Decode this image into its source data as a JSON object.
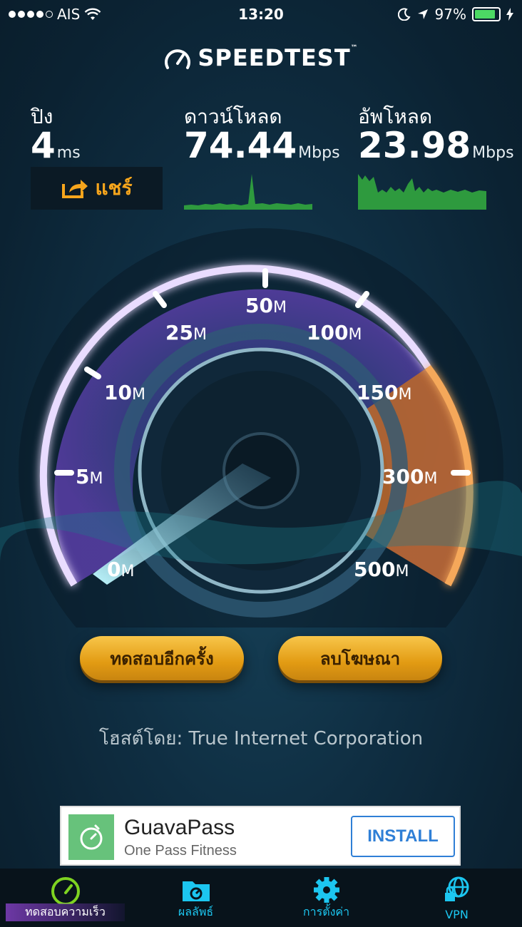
{
  "status_bar": {
    "carrier": "AIS",
    "time": "13:20",
    "battery": "97%"
  },
  "app": {
    "title": "SPEEDTEST",
    "trademark": "™"
  },
  "metrics": {
    "ping": {
      "label": "ปิง",
      "value": "4",
      "unit": "ms"
    },
    "download": {
      "label": "ดาวน์โหลด",
      "value": "74.44",
      "unit": "Mbps"
    },
    "upload": {
      "label": "อัพโหลด",
      "value": "23.98",
      "unit": "Mbps"
    }
  },
  "share_label": "แชร์",
  "gauge": {
    "ticks": [
      "0",
      "5",
      "10",
      "25",
      "50",
      "100",
      "150",
      "300",
      "500"
    ],
    "unit": "M"
  },
  "buttons": {
    "test_again": "ทดสอบอีกครั้ง",
    "remove_ads": "ลบโฆษณา"
  },
  "host": "โฮสต์โดย: True Internet Corporation",
  "ad": {
    "title": "GuavaPass",
    "subtitle": "One Pass Fitness",
    "install": "INSTALL"
  },
  "tabs": [
    {
      "label": "ทดสอบความเร็ว",
      "icon": "speedometer-icon"
    },
    {
      "label": "ผลลัพธ์",
      "icon": "results-folder-icon"
    },
    {
      "label": "การตั้งค่า",
      "icon": "gear-icon"
    },
    {
      "label": "VPN",
      "icon": "vpn-globe-icon"
    }
  ],
  "colors": {
    "accent_orange": "#f6a51c",
    "accent_cyan": "#1cc6f0",
    "gauge_purple": "#6b4bb8",
    "gauge_orange": "#e8842a",
    "sparkline_green": "#2e9a3e"
  }
}
